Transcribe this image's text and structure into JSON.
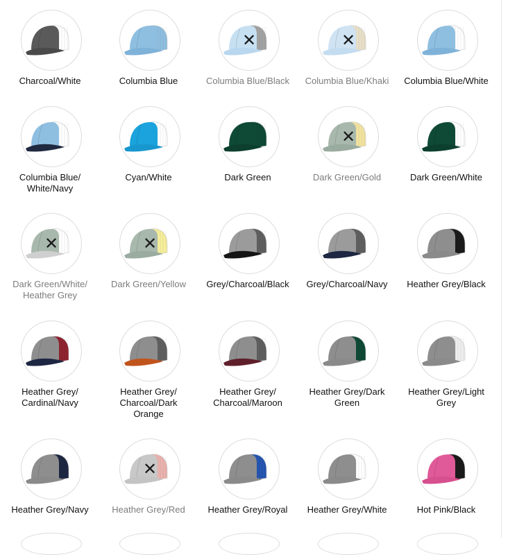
{
  "swatches": [
    {
      "label": "Charcoal/White",
      "available": true,
      "colors": {
        "front": "#5a5a5a",
        "mesh": "#ffffff",
        "bill": "#4a4a4a"
      },
      "icon": "cap-icon"
    },
    {
      "label": "Columbia Blue",
      "available": true,
      "colors": {
        "front": "#8fbfe0",
        "mesh": "#8fbfe0",
        "bill": "#7fb2d8"
      },
      "icon": "cap-icon"
    },
    {
      "label": "Columbia Blue/Black",
      "available": false,
      "colors": {
        "front": "#c6e0f2",
        "mesh": "#a3a3a3",
        "bill": "#b9d7ee"
      },
      "icon": "cap-icon"
    },
    {
      "label": "Columbia Blue/Khaki",
      "available": false,
      "colors": {
        "front": "#cfe3f3",
        "mesh": "#e8e0c8",
        "bill": "#c4dcef"
      },
      "icon": "cap-icon"
    },
    {
      "label": "Columbia Blue/White",
      "available": true,
      "colors": {
        "front": "#8fbfe0",
        "mesh": "#ffffff",
        "bill": "#7fb2d8"
      },
      "icon": "cap-icon"
    },
    {
      "label": "Columbia Blue/\nWhite/Navy",
      "available": true,
      "colors": {
        "front": "#8fbfe0",
        "mesh": "#ffffff",
        "bill": "#1f2940"
      },
      "icon": "cap-icon"
    },
    {
      "label": "Cyan/White",
      "available": true,
      "colors": {
        "front": "#1aa3dc",
        "mesh": "#ffffff",
        "bill": "#1897cf"
      },
      "icon": "cap-icon"
    },
    {
      "label": "Dark Green",
      "available": true,
      "colors": {
        "front": "#0f4a36",
        "mesh": "#0f4a36",
        "bill": "#0c3f2d"
      },
      "icon": "cap-icon"
    },
    {
      "label": "Dark Green/Gold",
      "available": false,
      "colors": {
        "front": "#a8b8ad",
        "mesh": "#f3e3a0",
        "bill": "#9aab9f"
      },
      "icon": "cap-icon"
    },
    {
      "label": "Dark Green/White",
      "available": true,
      "colors": {
        "front": "#0f4a36",
        "mesh": "#ffffff",
        "bill": "#0c3f2d"
      },
      "icon": "cap-icon"
    },
    {
      "label": "Dark Green/White/\nHeather Grey",
      "available": false,
      "colors": {
        "front": "#a8b8ad",
        "mesh": "#ffffff",
        "bill": "#cfcfcf"
      },
      "icon": "cap-icon"
    },
    {
      "label": "Dark Green/Yellow",
      "available": false,
      "colors": {
        "front": "#a8b8ad",
        "mesh": "#f6ee9b",
        "bill": "#9aab9f"
      },
      "icon": "cap-icon"
    },
    {
      "label": "Grey/Charcoal/Black",
      "available": true,
      "colors": {
        "front": "#9b9b9b",
        "mesh": "#5f5f5f",
        "bill": "#151515"
      },
      "icon": "cap-icon"
    },
    {
      "label": "Grey/Charcoal/Navy",
      "available": true,
      "colors": {
        "front": "#9b9b9b",
        "mesh": "#5f5f5f",
        "bill": "#1d2742"
      },
      "icon": "cap-icon"
    },
    {
      "label": "Heather Grey/Black",
      "available": true,
      "colors": {
        "front": "#8e8e8e",
        "mesh": "#1b1b1b",
        "bill": "#8a8a8a"
      },
      "icon": "cap-icon"
    },
    {
      "label": "Heather Grey/\nCardinal/Navy",
      "available": true,
      "colors": {
        "front": "#8e8e8e",
        "mesh": "#8e2430",
        "bill": "#1d2742"
      },
      "icon": "cap-icon"
    },
    {
      "label": "Heather Grey/\nCharcoal/Dark\nOrange",
      "available": true,
      "colors": {
        "front": "#8e8e8e",
        "mesh": "#5f5f5f",
        "bill": "#c0541d"
      },
      "icon": "cap-icon"
    },
    {
      "label": "Heather Grey/\nCharcoal/Maroon",
      "available": true,
      "colors": {
        "front": "#8e8e8e",
        "mesh": "#5f5f5f",
        "bill": "#5e1f2b"
      },
      "icon": "cap-icon"
    },
    {
      "label": "Heather Grey/Dark\nGreen",
      "available": true,
      "colors": {
        "front": "#8e8e8e",
        "mesh": "#0f4a36",
        "bill": "#8a8a8a"
      },
      "icon": "cap-icon"
    },
    {
      "label": "Heather Grey/Light\nGrey",
      "available": true,
      "colors": {
        "front": "#8e8e8e",
        "mesh": "#eeeeee",
        "bill": "#8a8a8a"
      },
      "icon": "cap-icon"
    },
    {
      "label": "Heather Grey/Navy",
      "available": true,
      "colors": {
        "front": "#8e8e8e",
        "mesh": "#1d2742",
        "bill": "#8a8a8a"
      },
      "icon": "cap-icon"
    },
    {
      "label": "Heather Grey/Red",
      "available": false,
      "colors": {
        "front": "#c8c8c8",
        "mesh": "#eab3ae",
        "bill": "#c4c4c4"
      },
      "icon": "cap-icon"
    },
    {
      "label": "Heather Grey/Royal",
      "available": true,
      "colors": {
        "front": "#8e8e8e",
        "mesh": "#2556b0",
        "bill": "#8a8a8a"
      },
      "icon": "cap-icon"
    },
    {
      "label": "Heather Grey/White",
      "available": true,
      "colors": {
        "front": "#8e8e8e",
        "mesh": "#ffffff",
        "bill": "#8a8a8a"
      },
      "icon": "cap-icon"
    },
    {
      "label": "Hot Pink/Black",
      "available": true,
      "colors": {
        "front": "#e05a99",
        "mesh": "#1b1b1b",
        "bill": "#d64f8e"
      },
      "icon": "cap-icon"
    }
  ],
  "unavailable_mark": "✕",
  "unavailable_icon": "close-icon"
}
